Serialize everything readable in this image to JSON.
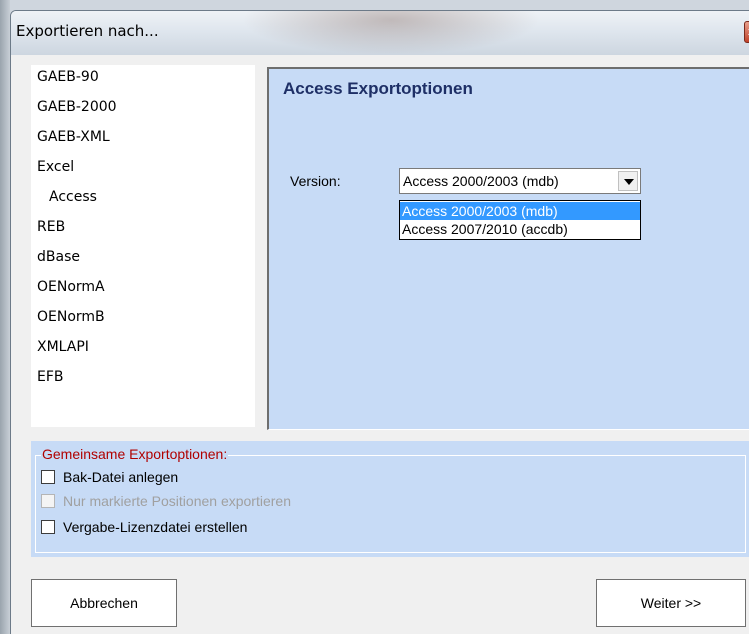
{
  "window": {
    "title": "Exportieren nach...",
    "close_icon": "close-icon"
  },
  "format_list": [
    {
      "label": "GAEB-90"
    },
    {
      "label": "GAEB-2000"
    },
    {
      "label": "GAEB-XML"
    },
    {
      "label": "Excel"
    },
    {
      "label": "Access"
    },
    {
      "label": "REB"
    },
    {
      "label": "dBase"
    },
    {
      "label": "OENormA"
    },
    {
      "label": "OENormB"
    },
    {
      "label": "XMLAPI"
    },
    {
      "label": "EFB"
    }
  ],
  "options": {
    "title": "Access Exportoptionen",
    "version_label": "Version:",
    "version_value": "Access 2000/2003 (mdb)",
    "version_options": [
      "Access 2000/2003 (mdb)",
      "Access 2007/2010 (accdb)"
    ]
  },
  "common": {
    "legend": "Gemeinsame Exportoptionen:",
    "checkboxes": [
      {
        "label": "Bak-Datei anlegen",
        "checked": false,
        "enabled": true
      },
      {
        "label": "Nur markierte Positionen exportieren",
        "checked": false,
        "enabled": false
      },
      {
        "label": "Vergabe-Lizenzdatei erstellen",
        "checked": false,
        "enabled": true
      }
    ]
  },
  "buttons": {
    "cancel": "Abbrechen",
    "next": "Weiter >>"
  },
  "colors": {
    "panel_bg": "#c7dbf6",
    "options_title": "#1e2f66",
    "legend_text": "#b00000",
    "selection": "#3399ff"
  }
}
